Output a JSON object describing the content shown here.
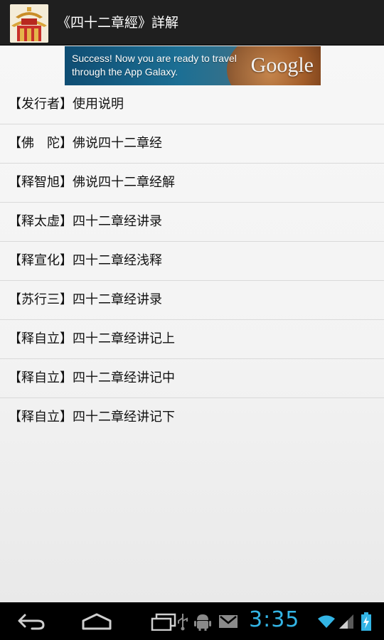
{
  "app": {
    "title": "《四十二章經》詳解",
    "icon": "temple-roof-icon"
  },
  "ad": {
    "text": "Success! Now you are ready to travel through the App Galaxy.",
    "logo": "Google"
  },
  "list": {
    "items": [
      {
        "label": "【发行者】使用说明"
      },
      {
        "label": "【佛　陀】佛说四十二章经"
      },
      {
        "label": "【释智旭】佛说四十二章经解"
      },
      {
        "label": "【释太虚】四十二章经讲录"
      },
      {
        "label": "【释宣化】四十二章经浅释"
      },
      {
        "label": "【苏行三】四十二章经讲录"
      },
      {
        "label": "【释自立】四十二章经讲记上"
      },
      {
        "label": "【释自立】四十二章经讲记中"
      },
      {
        "label": "【释自立】四十二章经讲记下"
      }
    ]
  },
  "system_bar": {
    "time": "3:35",
    "buttons": [
      "back-icon",
      "home-icon",
      "recent-apps-icon"
    ],
    "status_icons": [
      "usb-icon",
      "android-debug-icon",
      "gmail-icon",
      "wifi-icon",
      "signal-icon",
      "battery-charging-icon"
    ],
    "accent_color": "#33b5e5"
  }
}
